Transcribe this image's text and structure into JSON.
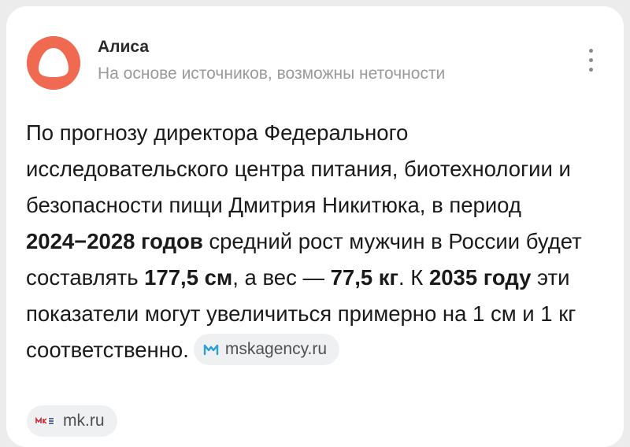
{
  "header": {
    "title": "Алиса",
    "subtitle": "На основе источников, возможны неточности",
    "menu_icon": "vertical-dots-icon",
    "avatar_color": "#f06a52"
  },
  "answer": {
    "p1": "По прогнозу директора Федерального исследовательского центра питания, биотехнологии и безопасности пищи Дмитрия Никитюка, в период ",
    "b1": "2024−2028 годов",
    "p2": " средний рост мужчин в России будет составлять ",
    "b2": "177,5 см",
    "p3": ", а вес —  ",
    "b3": "77,5 кг",
    "p4": ". К ",
    "b4": "2035 году",
    "p5": " эти показатели могут увеличиться примерно на 1 см и 1 кг соответственно."
  },
  "sources": [
    {
      "label": "mskagency.ru",
      "icon": "mskagency-logo-icon",
      "color": "#2a9fd8"
    },
    {
      "label": "mk.ru",
      "icon": "mk-logo-icon",
      "color": "#d9232d"
    }
  ]
}
